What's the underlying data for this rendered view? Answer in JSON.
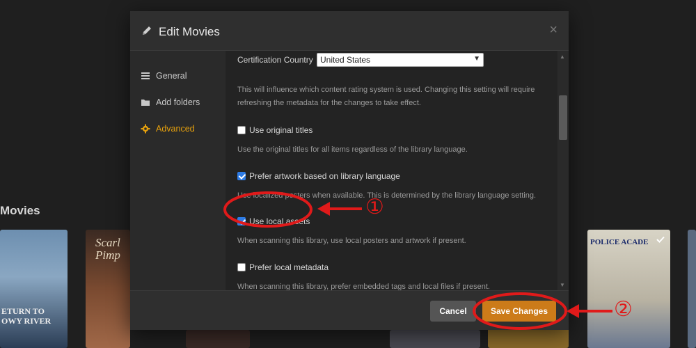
{
  "background": {
    "section_title": "Movies",
    "posters": [
      {
        "title_text": "ETURN TO\nOWY RIVER",
        "color": "#4a6a8a"
      },
      {
        "title_text": "Scarl\nPimp",
        "color": "#5a3a2a"
      },
      {
        "title_text": "POLICE ACADE",
        "color": "#c9c4b8"
      }
    ]
  },
  "modal": {
    "title": "Edit Movies",
    "close_glyph": "×",
    "icons": {
      "title": "pencil-icon",
      "close": "close-icon"
    },
    "sidebar": [
      {
        "label": "General",
        "icon": "list-icon",
        "active": false
      },
      {
        "label": "Add folders",
        "icon": "folder-icon",
        "active": false
      },
      {
        "label": "Advanced",
        "icon": "gear-icon",
        "active": true
      }
    ],
    "certification": {
      "label": "Certification Country",
      "value": "United States",
      "description": "This will influence which content rating system is used. Changing this setting will require refreshing the metadata for the changes to take effect."
    },
    "options": [
      {
        "label": "Use original titles",
        "checked": false,
        "description": "Use the original titles for all items regardless of the library language."
      },
      {
        "label": "Prefer artwork based on library language",
        "checked": true,
        "description": "Use localized posters when available. This is determined by the library language setting."
      },
      {
        "label": "Use local assets",
        "checked": true,
        "description": "When scanning this library, use local posters and artwork if present."
      },
      {
        "label": "Prefer local metadata",
        "checked": false,
        "description": "When scanning this library, prefer embedded tags and local files if present."
      }
    ],
    "footer": {
      "cancel_label": "Cancel",
      "save_label": "Save Changes"
    }
  },
  "annotations": {
    "marker_1": "①",
    "marker_2": "②",
    "color": "#e01a1a"
  },
  "colors": {
    "accent": "#e5a00d",
    "save_button": "#cc7b19",
    "checkbox_on": "#2d7be5"
  }
}
